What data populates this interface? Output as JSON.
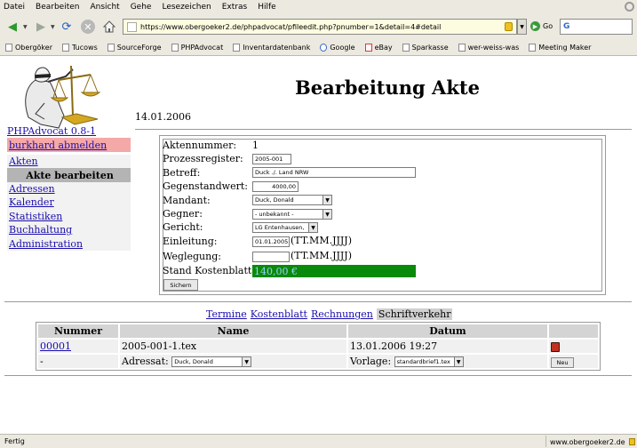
{
  "browser": {
    "menu": [
      "Datei",
      "Bearbeiten",
      "Ansicht",
      "Gehe",
      "Lesezeichen",
      "Extras",
      "Hilfe"
    ],
    "url": "https://www.obergoeker2.de/phpadvocat/pfileedit.php?pnumber=1&detail=4#detail",
    "go_label": "Go",
    "search_value": "G",
    "bookmarks": [
      "Obergöker",
      "Tucows",
      "SourceForge",
      "PHPAdvocat",
      "Inventardatenbank",
      "Google",
      "eBay",
      "Sparkasse",
      "wer-weiss-was",
      "Meeting Maker"
    ],
    "status_left": "Fertig",
    "status_right": "www.obergoeker2.de"
  },
  "sidebar": {
    "version": "PHPAdvocat 0.8-1",
    "logout": "burkhard abmelden",
    "akten": "Akten",
    "akte_bearbeiten": "Akte bearbeiten",
    "items": [
      "Adressen",
      "Kalender",
      "Statistiken",
      "Buchhaltung",
      "Administration"
    ]
  },
  "page": {
    "title": "Bearbeitung Akte",
    "date": "14.01.2006"
  },
  "form": {
    "aktennummer_label": "Aktennummer:",
    "aktennummer_value": "1",
    "prozessregister_label": "Prozessregister:",
    "prozessregister_value": "2005-001",
    "betreff_label": "Betreff:",
    "betreff_value": "Duck ./. Land NRW",
    "gegenstandwert_label": "Gegenstandwert:",
    "gegenstandwert_value": "4000,00",
    "mandant_label": "Mandant:",
    "mandant_value": "Duck, Donald",
    "gegner_label": "Gegner:",
    "gegner_value": "- unbekannt -",
    "gericht_label": "Gericht:",
    "gericht_value": "LG Entenhausen,",
    "einleitung_label": "Einleitung:",
    "einleitung_value": "01.01.2005",
    "weglegung_label": "Weglegung:",
    "weglegung_value": "",
    "date_hint": "(TT.MM.JJJJ)",
    "kostenblatt_label": "Stand Kostenblatt:",
    "kostenblatt_value": "140,00 €",
    "save_label": "Sichern"
  },
  "tabs": [
    "Termine",
    "Kostenblatt",
    "Rechnungen",
    "Schriftverkehr"
  ],
  "documents": {
    "columns": [
      "Nummer",
      "Name",
      "Datum"
    ],
    "rows": [
      {
        "nummer": "00001",
        "name": "2005-001-1.tex",
        "datum": "13.01.2006 19:27"
      }
    ],
    "new_row": {
      "dash": "-",
      "adressat_label": "Adressat:",
      "adressat_value": "Duck, Donald",
      "vorlage_label": "Vorlage:",
      "vorlage_value": "standardbrief1.tex",
      "new_label": "Neu"
    }
  }
}
